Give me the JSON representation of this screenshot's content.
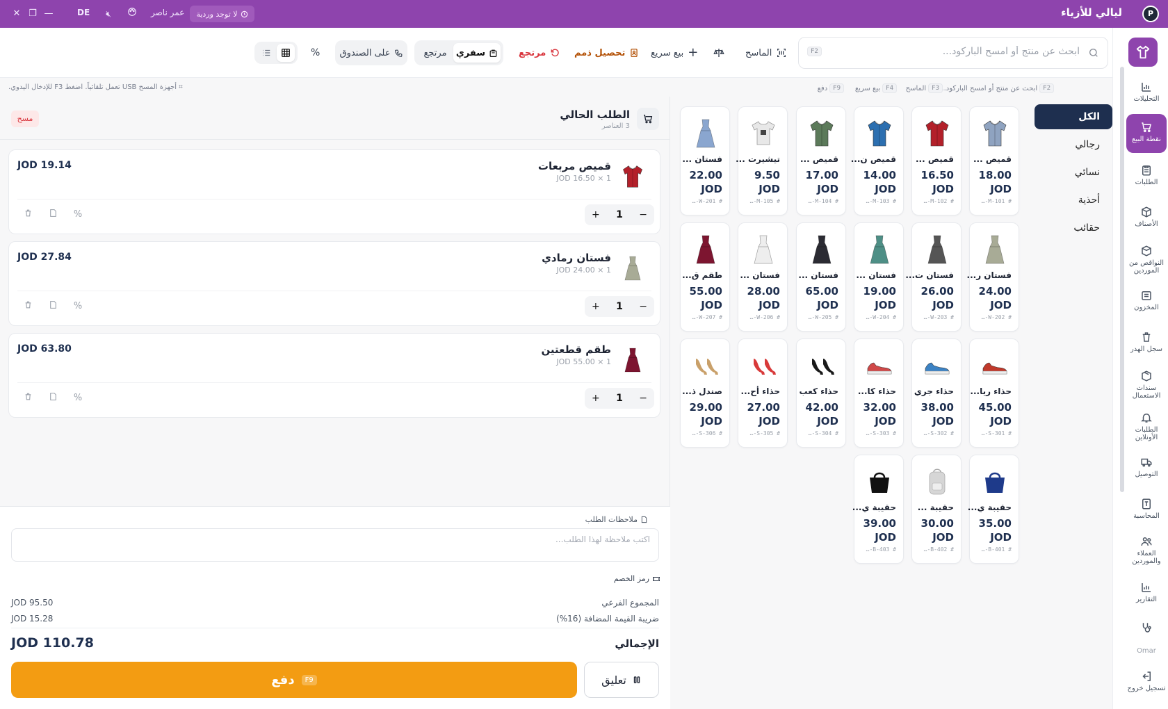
{
  "titlebar": {
    "app_name": "ليالي للأزياء",
    "logo_letter": "P",
    "shift_status": "لا توجد وردية",
    "user": "عمر ناصر",
    "lang": "DE"
  },
  "sidebar": {
    "items": [
      {
        "label": "التحليلات",
        "icon": "chart-icon"
      },
      {
        "label": "نقطة البيع",
        "icon": "cart-icon",
        "active": true
      },
      {
        "label": "الطلبات",
        "icon": "clipboard-icon"
      },
      {
        "label": "الأصناف",
        "icon": "box-icon"
      },
      {
        "label": "النواقص من الموردين",
        "icon": "box-alert-icon"
      },
      {
        "label": "المخزون",
        "icon": "warehouse-icon"
      },
      {
        "label": "سجل الهدر",
        "icon": "trash-icon"
      },
      {
        "label": "سندات الاستعمال",
        "icon": "package-icon"
      },
      {
        "label": "الطلبات الأونلاين",
        "icon": "bell-icon"
      },
      {
        "label": "التوصيل",
        "icon": "truck-icon"
      },
      {
        "label": "المحاسبة",
        "icon": "receipt-icon"
      },
      {
        "label": "العملاء والموردين",
        "icon": "users-icon"
      },
      {
        "label": "التقارير",
        "icon": "report-icon"
      }
    ],
    "user_short": "Omar",
    "logout_label": "تسجيل خروج"
  },
  "toolbar": {
    "search_placeholder": "ابحث عن منتج أو امسح الباركود...",
    "search_key": "F2",
    "scanner_label": "الماسح",
    "quick_sale_label": "بيع سريع",
    "collect_debt_label": "تحصيل ذمم",
    "return_label": "مرتجع",
    "mode_options": [
      "سفري",
      "مرتجع",
      "على الصندوق"
    ],
    "mode_selected": "سفري",
    "percent_symbol": "%"
  },
  "hints": {
    "search": "ابحث عن منتج أو امسح الباركود...",
    "search_key": "F2",
    "scanner": "الماسح",
    "scanner_key": "F3",
    "quick_sale": "بيع سريع",
    "quick_sale_key": "F4",
    "pay": "دفع",
    "pay_key": "F9",
    "usb_note": "أجهزة المسح USB تعمل تلقائياً. اضغط F3 للإدخال اليدوي."
  },
  "categories": [
    "الكل",
    "رجالي",
    "نسائي",
    "أحذية",
    "حقائب"
  ],
  "products": [
    {
      "name": "قميص ...",
      "price": "18.00",
      "currency": "JOD",
      "sku": "# M-101-…",
      "icon": "shirt-icon",
      "color": "#8fa3c0"
    },
    {
      "name": "قميص ...",
      "price": "16.50",
      "currency": "JOD",
      "sku": "# M-102-…",
      "icon": "shirt-icon",
      "color": "#b3202a"
    },
    {
      "name": "قميص ن...",
      "price": "14.00",
      "currency": "JOD",
      "sku": "# M-103-…",
      "icon": "shirt-icon",
      "color": "#2c6fb0"
    },
    {
      "name": "قميص ...",
      "price": "17.00",
      "currency": "JOD",
      "sku": "# M-104-…",
      "icon": "shirt-icon",
      "color": "#5c7a5a"
    },
    {
      "name": "تيشيرت ...",
      "price": "9.50",
      "currency": "JOD",
      "sku": "# M-105-…",
      "icon": "tshirt-icon",
      "color": "#e8e8e8"
    },
    {
      "name": "فستان ...",
      "price": "22.00",
      "currency": "JOD",
      "sku": "# W-201-…",
      "icon": "dress-icon",
      "color": "#8aa6cf"
    },
    {
      "name": "فستان ر...",
      "price": "24.00",
      "currency": "JOD",
      "sku": "# W-202-…",
      "icon": "dress-icon",
      "color": "#a8ab96"
    },
    {
      "name": "فستان ت...",
      "price": "26.00",
      "currency": "JOD",
      "sku": "# W-203-…",
      "icon": "dress-icon",
      "color": "#555"
    },
    {
      "name": "فستان ...",
      "price": "19.00",
      "currency": "JOD",
      "sku": "# W-204-…",
      "icon": "dress-icon",
      "color": "#4e8f86"
    },
    {
      "name": "فستان ...",
      "price": "65.00",
      "currency": "JOD",
      "sku": "# W-205-…",
      "icon": "dress-icon",
      "color": "#2b2b33"
    },
    {
      "name": "فستان ...",
      "price": "28.00",
      "currency": "JOD",
      "sku": "# W-206-…",
      "icon": "dress-icon",
      "color": "#eeeeee"
    },
    {
      "name": "طقم ق...",
      "price": "55.00",
      "currency": "JOD",
      "sku": "# W-207-…",
      "icon": "dress-icon",
      "color": "#7d1530"
    },
    {
      "name": "حذاء ريا...",
      "price": "45.00",
      "currency": "JOD",
      "sku": "# S-301-…",
      "icon": "shoe-icon",
      "color": "#c0392b"
    },
    {
      "name": "حذاء جري",
      "price": "38.00",
      "currency": "JOD",
      "sku": "# S-302-…",
      "icon": "shoe-icon",
      "color": "#3b82c4"
    },
    {
      "name": "حذاء كا...",
      "price": "32.00",
      "currency": "JOD",
      "sku": "# S-303-…",
      "icon": "shoe-icon",
      "color": "#d04848"
    },
    {
      "name": "حذاء كعب",
      "price": "42.00",
      "currency": "JOD",
      "sku": "# S-304-…",
      "icon": "heel-icon",
      "color": "#1a1a1a"
    },
    {
      "name": "حذاء أح...",
      "price": "27.00",
      "currency": "JOD",
      "sku": "# S-305-…",
      "icon": "heel-icon",
      "color": "#d83a3a"
    },
    {
      "name": "صندل ذ...",
      "price": "29.00",
      "currency": "JOD",
      "sku": "# S-306-…",
      "icon": "heel-icon",
      "color": "#c9a06a"
    },
    {
      "name": "حقيبة ي...",
      "price": "35.00",
      "currency": "JOD",
      "sku": "# B-401-…",
      "icon": "bag-icon",
      "color": "#1e3a8a"
    },
    {
      "name": "حقيبة ...",
      "price": "30.00",
      "currency": "JOD",
      "sku": "# B-402-…",
      "icon": "backpack-icon",
      "color": "#d6d6d6"
    },
    {
      "name": "حقيبة ي...",
      "price": "39.00",
      "currency": "JOD",
      "sku": "# B-403-…",
      "icon": "bag-icon",
      "color": "#111"
    }
  ],
  "cart": {
    "title": "الطلب الحالي",
    "count_label": "3 العناصر",
    "clear_label": "مسح",
    "lines": [
      {
        "name": "قميص مربعات",
        "unit": "JOD 16.50",
        "qty": "1",
        "total": "JOD 19.14",
        "icon": "shirt-icon",
        "color": "#b3202a"
      },
      {
        "name": "فستان رمادي",
        "unit": "JOD 24.00",
        "qty": "1",
        "total": "JOD 27.84",
        "icon": "dress-icon",
        "color": "#a8ab96"
      },
      {
        "name": "طقم قطعتين",
        "unit": "JOD 55.00",
        "qty": "1",
        "total": "JOD 63.80",
        "icon": "dress-icon",
        "color": "#7d1530"
      }
    ],
    "notes_label": "ملاحظات الطلب",
    "notes_placeholder": "اكتب ملاحظة لهذا الطلب...",
    "discount_label": "رمز الخصم",
    "subtotal_label": "المجموع الفرعي",
    "subtotal_value": "JOD 95.50",
    "tax_label": "ضريبة القيمة المضافة (16%)",
    "tax_value": "JOD 15.28",
    "total_label": "الإجمالي",
    "total_value": "JOD 110.78",
    "pay_label": "دفع",
    "pay_key": "F9",
    "hold_label": "تعليق"
  },
  "colors": {
    "brand": "#8e44ad",
    "pay": "#f39c12",
    "navy": "#1e2f4f",
    "danger": "#d9363e"
  }
}
